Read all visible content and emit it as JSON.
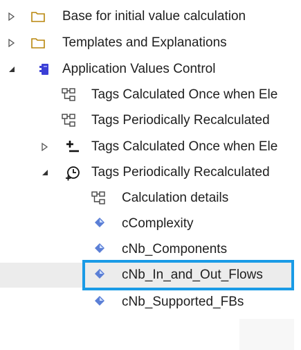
{
  "tree": {
    "items": [
      {
        "label": "Base for initial value calculation",
        "icon": "folder-icon",
        "toggle": "collapsed"
      },
      {
        "label": "Templates and Explanations",
        "icon": "folder-icon",
        "toggle": "collapsed"
      },
      {
        "label": "Application Values Control",
        "icon": "package-icon",
        "toggle": "expanded"
      },
      {
        "label": "Tags Calculated Once when Ele",
        "icon": "diagram-icon",
        "toggle": "none"
      },
      {
        "label": "Tags Periodically Recalculated",
        "icon": "diagram-icon",
        "toggle": "none"
      },
      {
        "label": "Tags Calculated Once when Ele",
        "icon": "plus-minus-icon",
        "toggle": "collapsed"
      },
      {
        "label": "Tags Periodically Recalculated",
        "icon": "clock-icon",
        "toggle": "expanded"
      },
      {
        "label": "Calculation details",
        "icon": "diagram-icon",
        "toggle": "none"
      },
      {
        "label": "cComplexity",
        "icon": "tag-icon",
        "toggle": "none"
      },
      {
        "label": "cNb_Components",
        "icon": "tag-icon",
        "toggle": "none"
      },
      {
        "label": "cNb_In_and_Out_Flows",
        "icon": "tag-icon",
        "toggle": "none",
        "selected": true
      },
      {
        "label": "cNb_Supported_FBs",
        "icon": "tag-icon",
        "toggle": "none"
      }
    ]
  },
  "colors": {
    "selection_border": "#1a9be6",
    "hover_background": "#ececec",
    "folder": "#b8860b",
    "package": "#3b3fd6",
    "tag": "#5b7fd6"
  }
}
